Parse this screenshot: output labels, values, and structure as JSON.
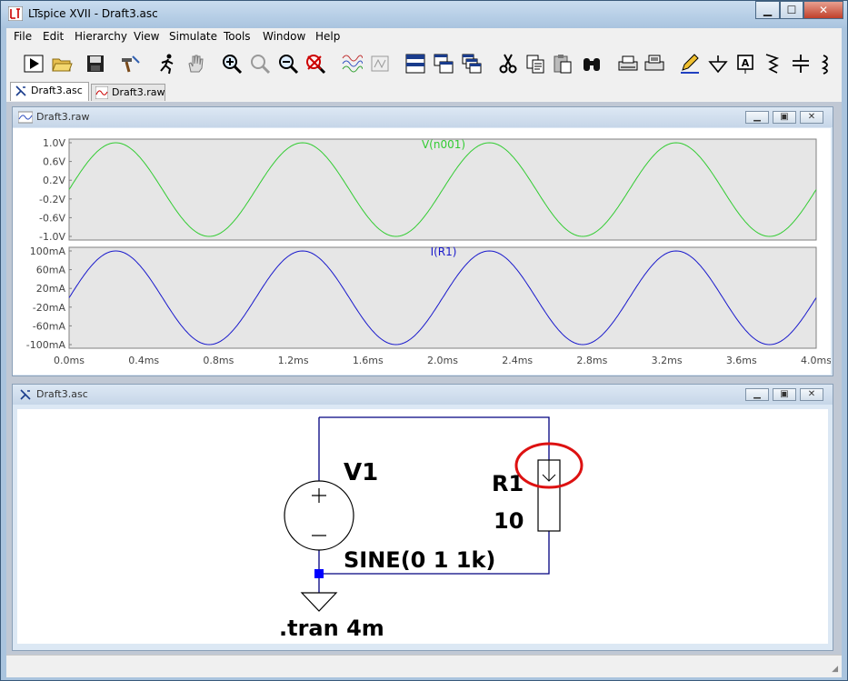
{
  "window": {
    "title": "LTspice XVII - Draft3.asc"
  },
  "menu": [
    "File",
    "Edit",
    "Hierarchy",
    "View",
    "Simulate",
    "Tools",
    "Window",
    "Help"
  ],
  "toolbar": [
    "run",
    "open",
    "save",
    "control-panel",
    "halt",
    "pan",
    "zoom-in",
    "zoom-area",
    "zoom-out",
    "zoom-fit",
    "autorange",
    "waveform",
    "tile-horizontal",
    "tile-vertical",
    "cascade",
    "cut",
    "copy",
    "paste",
    "find",
    "print-setup",
    "print",
    "draw-wire",
    "ground",
    "label",
    "resistor",
    "capacitor",
    "inductor"
  ],
  "tabs": [
    {
      "label": "Draft3.asc",
      "icon": "schematic-icon",
      "active": true
    },
    {
      "label": "Draft3.raw",
      "icon": "waveform-icon",
      "active": false
    }
  ],
  "waveform_window": {
    "title": "Draft3.raw",
    "traces": [
      {
        "name": "V(n001)",
        "color": "#33cc33",
        "ticks": [
          "1.0V",
          "0.6V",
          "0.2V",
          "-0.2V",
          "-0.6V",
          "-1.0V"
        ]
      },
      {
        "name": "I(R1)",
        "color": "#1a1acc",
        "ticks": [
          "100mA",
          "60mA",
          "20mA",
          "-20mA",
          "-60mA",
          "-100mA"
        ]
      }
    ],
    "xticks": [
      "0.0ms",
      "0.4ms",
      "0.8ms",
      "1.2ms",
      "1.6ms",
      "2.0ms",
      "2.4ms",
      "2.8ms",
      "3.2ms",
      "3.6ms",
      "4.0ms"
    ]
  },
  "schematic_window": {
    "title": "Draft3.asc",
    "source_name": "V1",
    "source_value": "SINE(0 1 1k)",
    "resistor_name": "R1",
    "resistor_value": "10",
    "directive": ".tran 4m",
    "highlight_color": "#dd1111"
  },
  "chart_data": {
    "type": "line",
    "x": [
      0,
      0.4,
      0.8,
      1.2,
      1.6,
      2.0,
      2.4,
      2.8,
      3.2,
      3.6,
      4.0
    ],
    "xlabel": "",
    "xlim": [
      0,
      4.0
    ],
    "series": [
      {
        "name": "V(n001)",
        "function": "sin(2*pi*1000*t)",
        "amplitude": 1.0,
        "frequency_khz": 1,
        "ylim": [
          -1.0,
          1.0
        ]
      },
      {
        "name": "I(R1)",
        "function": "0.1*sin(2*pi*1000*t)",
        "amplitude": 100,
        "frequency_khz": 1,
        "ylim": [
          -100,
          100
        ]
      }
    ],
    "grid": false
  }
}
